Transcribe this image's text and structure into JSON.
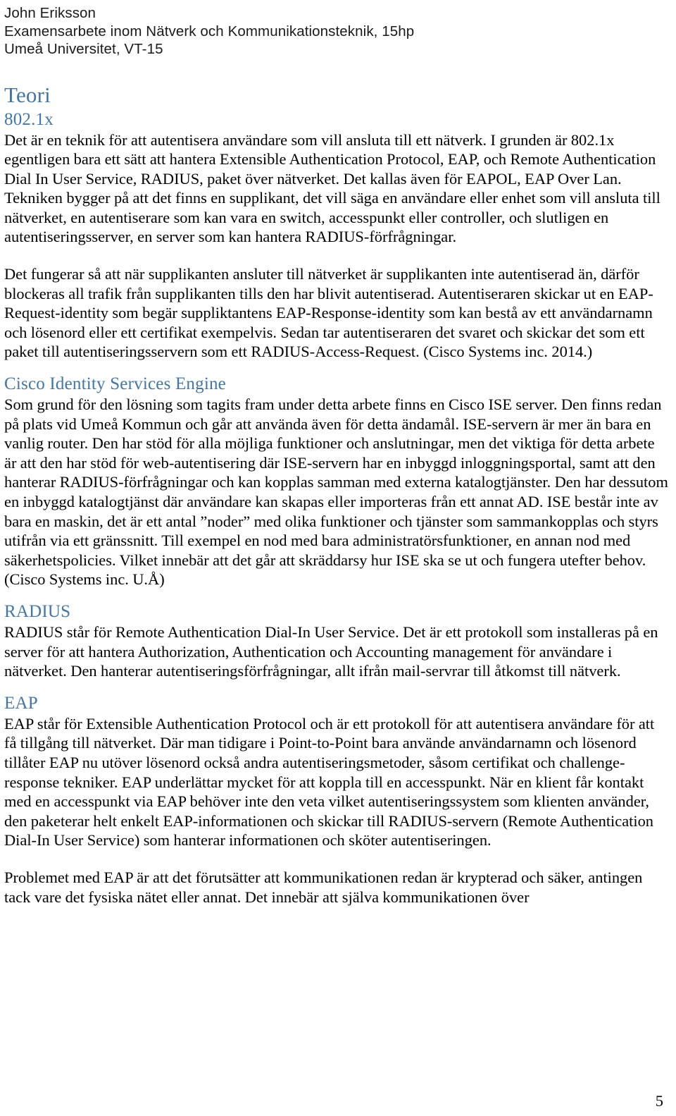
{
  "header": {
    "author": "John Eriksson",
    "program": "Examensarbete inom Nätverk och Kommunikationsteknik, 15hp",
    "institution": "Umeå Universitet, VT-15"
  },
  "colors": {
    "heading_blue": "#4276A7",
    "body_black": "#000000",
    "page_background": "#FFFFFF"
  },
  "sections": {
    "chapter_title": "Teori",
    "dot1x": {
      "heading": "802.1x",
      "paragraph_1": "Det är en teknik för att autentisera användare som vill ansluta till ett nätverk. I grunden är 802.1x egentligen bara ett sätt att hantera Extensible Authentication Protocol, EAP, och Remote Authentication Dial In User Service, RADIUS, paket över nätverket. Det kallas även för EAPOL, EAP Over Lan. Tekniken bygger på att det finns en supplikant, det vill säga en användare eller enhet som vill ansluta till nätverket, en autentiserare som kan vara en switch, accesspunkt eller controller, och slutligen en autentiseringsserver, en server som kan hantera RADIUS-förfrågningar.",
      "paragraph_2": "Det fungerar så att när supplikanten ansluter till nätverket är supplikanten inte autentiserad än, därför blockeras all trafik från supplikanten tills den har blivit autentiserad. Autentiseraren skickar ut en EAP-Request-identity som begär suppliktantens EAP-Response-identity som kan bestå av ett användarnamn och lösenord eller ett certifikat exempelvis. Sedan tar autentiseraren det svaret och skickar det som ett paket till autentiseringsservern som ett RADIUS-Access-Request. (Cisco Systems inc. 2014.)"
    },
    "cisco_ise": {
      "heading": "Cisco Identity Services Engine",
      "paragraph_1": "Som grund för den lösning som tagits fram under detta arbete finns en Cisco ISE server. Den finns redan på plats vid Umeå Kommun och går att använda även för detta ändamål. ISE-servern är mer än bara en vanlig router. Den har stöd för alla möjliga funktioner och anslutningar, men det viktiga för detta arbete är att den har stöd för web-autentisering där ISE-servern har en inbyggd inloggningsportal, samt att den hanterar RADIUS-förfrågningar och kan kopplas samman med externa katalogtjänster. Den har dessutom en inbyggd katalogtjänst där användare kan skapas eller importeras från ett annat AD. ISE består inte av bara en maskin, det är ett antal ”noder” med olika funktioner och tjänster som sammankopplas och styrs utifrån via ett gränssnitt. Till exempel en nod med bara administratörsfunktioner, en annan nod med säkerhetspolicies. Vilket innebär att det går att skräddarsy hur ISE ska se ut och fungera utefter behov. (Cisco Systems inc. U.Å)"
    },
    "radius": {
      "heading": "RADIUS",
      "paragraph_1": "RADIUS står för Remote Authentication Dial-In User Service. Det är ett protokoll som installeras på en server för att hantera Authorization, Authentication och Accounting management för användare i nätverket. Den hanterar autentiseringsförfrågningar, allt ifrån mail-servrar till åtkomst till nätverk."
    },
    "eap": {
      "heading": "EAP",
      "paragraph_1": "EAP står för Extensible Authentication Protocol och är ett protokoll för att autentisera användare för att få tillgång till nätverket. Där man tidigare i Point-to-Point bara använde användarnamn och lösenord tillåter EAP nu utöver lösenord också andra autentiseringsmetoder, såsom certifikat och challenge-response tekniker. EAP underlättar mycket för att koppla till en accesspunkt. När en klient får kontakt med en accesspunkt via EAP behöver inte den veta vilket autentiseringssystem som klienten använder, den paketerar helt enkelt EAP-informationen och skickar till RADIUS-servern (Remote Authentication Dial-In User Service) som hanterar informationen och sköter autentiseringen.",
      "paragraph_2": "Problemet med EAP är att det förutsätter att kommunikationen redan är krypterad och säker, antingen tack vare det fysiska nätet eller annat. Det innebär att själva kommunikationen över"
    }
  },
  "footer": {
    "page_number": "5"
  }
}
